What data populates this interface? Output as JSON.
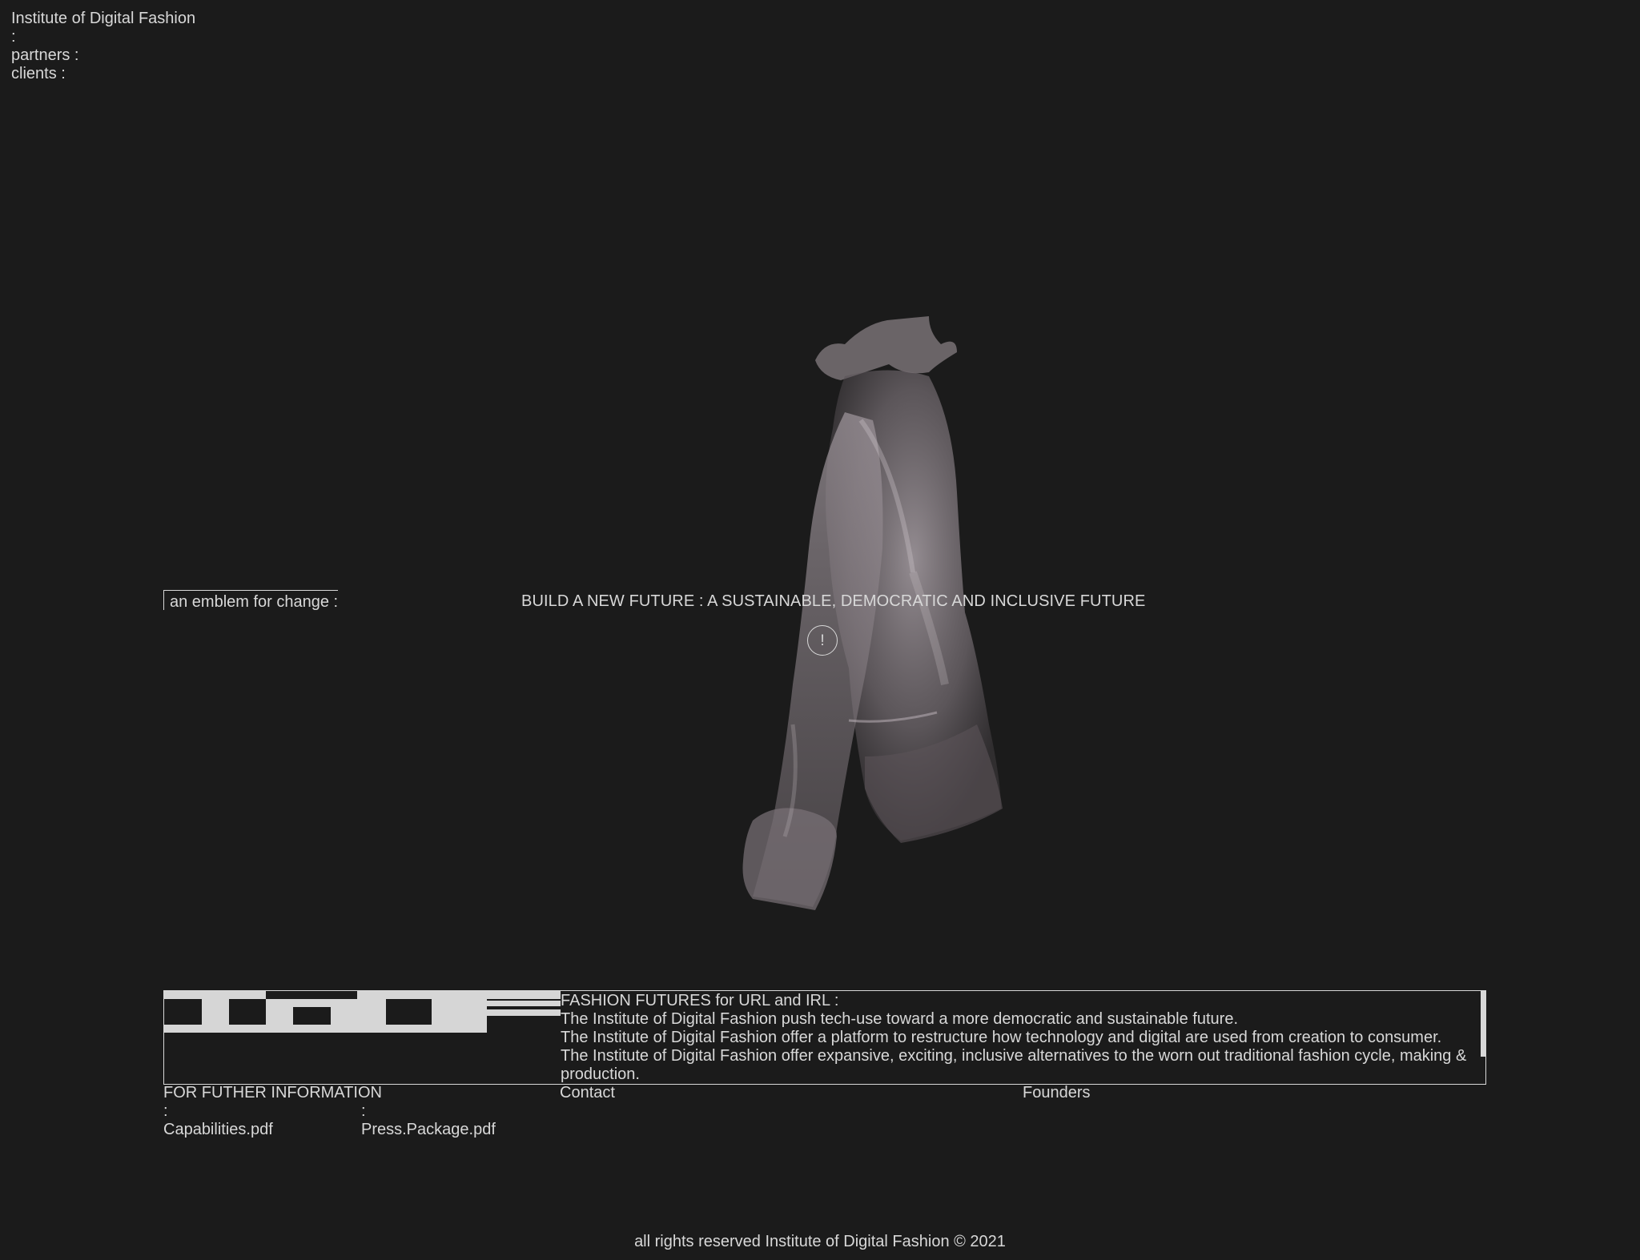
{
  "nav": {
    "brand": "Institute of Digital Fashion",
    "separator": ":",
    "partners": "partners :",
    "clients": "clients :"
  },
  "hero": {
    "emblem_label": "an emblem for change :",
    "headline": "BUILD A NEW FUTURE : A SUSTAINABLE, DEMOCRATIC AND INCLUSIVE FUTURE",
    "alert_symbol": "!",
    "image_icon": "sheer-organza-blouse-3d-render"
  },
  "info": {
    "heading": "FASHION FUTURES for URL and IRL :",
    "lines": [
      "The Institute of Digital Fashion push tech-use toward a more democratic and sustainable future.",
      "The Institute of Digital Fashion offer a platform to restructure how technology and digital are used from creation to consumer.",
      "The Institute of Digital Fashion offer expansive, exciting, inclusive alternatives to the worn out traditional fashion cycle, making & production."
    ],
    "logo_icon": "idf-pixel-logo"
  },
  "links": {
    "further_info": "FOR FUTHER INFORMATION",
    "contact": "Contact",
    "founders": "Founders",
    "colon": ":",
    "capabilities": "Capabilities.pdf",
    "press": "Press.Package.pdf"
  },
  "footer": {
    "text": "all rights reserved Institute of Digital Fashion © 2021"
  },
  "colors": {
    "background": "#1b1b1b",
    "text": "#d8d8d8",
    "logo": "#d6d6d6"
  }
}
